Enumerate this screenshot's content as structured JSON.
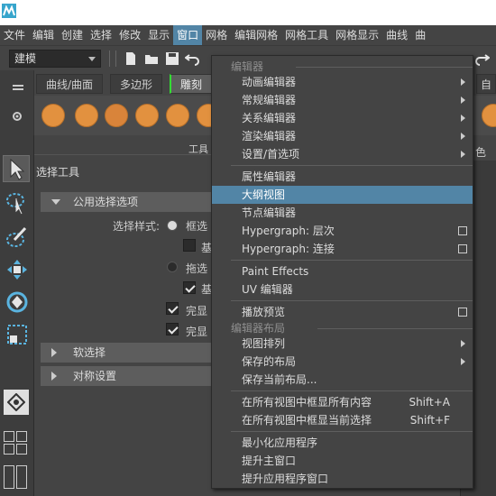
{
  "menubar": {
    "items": [
      {
        "label": "文件"
      },
      {
        "label": "编辑"
      },
      {
        "label": "创建"
      },
      {
        "label": "选择"
      },
      {
        "label": "修改"
      },
      {
        "label": "显示"
      },
      {
        "label": "窗口",
        "active": true
      },
      {
        "label": "网格"
      },
      {
        "label": "编辑网格"
      },
      {
        "label": "网格工具"
      },
      {
        "label": "网格显示"
      },
      {
        "label": "曲线"
      },
      {
        "label": "曲"
      }
    ]
  },
  "statusline": {
    "mode_value": "建模"
  },
  "shelf": {
    "tabs": [
      "曲线/曲面",
      "多边形",
      "雕刻"
    ],
    "right_tab_partial": "自定"
  },
  "tool_settings": {
    "header_partial": "工具",
    "tool_name": "选择工具",
    "sections": {
      "common": "公用选择选项",
      "soft": "软选择",
      "symmetry": "对称设置"
    },
    "select_style_label": "选择样式:",
    "opt_marquee": "框选",
    "opt_marquee_sub": "基",
    "opt_drag": "拖选",
    "opt_drag_sub": "基",
    "opt_complete1": "完显",
    "opt_complete2": "完显"
  },
  "right_panel": {
    "partial_label": "色"
  },
  "window_menu": {
    "section_editors": "编辑器",
    "items_editors": [
      {
        "label": "动画编辑器",
        "submenu": true
      },
      {
        "label": "常规编辑器",
        "submenu": true
      },
      {
        "label": "关系编辑器",
        "submenu": true
      },
      {
        "label": "渲染编辑器",
        "submenu": true
      },
      {
        "label": "设置/首选项",
        "submenu": true
      }
    ],
    "items_main": [
      {
        "label": "属性编辑器"
      },
      {
        "label": "大纲视图",
        "highlighted": true
      },
      {
        "label": "节点编辑器"
      },
      {
        "label": "Hypergraph: 层次",
        "option_box": true
      },
      {
        "label": "Hypergraph: 连接",
        "option_box": true
      }
    ],
    "items_effects": [
      {
        "label": "Paint Effects"
      },
      {
        "label": "UV 编辑器"
      }
    ],
    "playblast": {
      "label": "播放预览",
      "option_box": true
    },
    "section_layouts": "编辑器布局",
    "items_layouts": [
      {
        "label": "视图排列",
        "submenu": true
      },
      {
        "label": "保存的布局",
        "submenu": true
      },
      {
        "label": "保存当前布局..."
      }
    ],
    "frame_all": {
      "label": "在所有视图中框显所有内容",
      "shortcut": "Shift+A"
    },
    "frame_selected": {
      "label": "在所有视图中框显当前选择",
      "shortcut": "Shift+F"
    },
    "items_app": [
      {
        "label": "最小化应用程序"
      },
      {
        "label": "提升主窗口"
      },
      {
        "label": "提升应用程序窗口"
      }
    ]
  },
  "colors": {
    "menu_highlight": "#5285a6",
    "shelf_icon": "#e2913f",
    "panel_bg": "#444444"
  }
}
